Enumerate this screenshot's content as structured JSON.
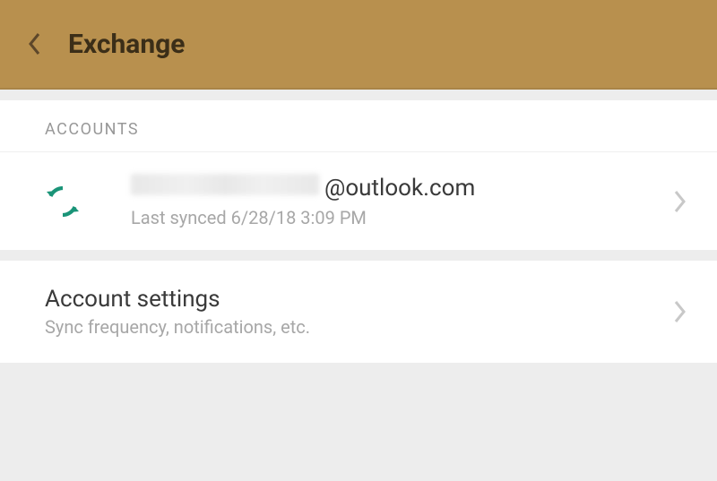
{
  "header": {
    "title": "Exchange"
  },
  "accounts_section": {
    "label": "ACCOUNTS",
    "items": [
      {
        "email_domain": "@outlook.com",
        "last_synced": "Last synced 6/28/18 3:09 PM"
      }
    ]
  },
  "settings_section": {
    "title": "Account settings",
    "subtitle": "Sync frequency, notifications, etc."
  }
}
